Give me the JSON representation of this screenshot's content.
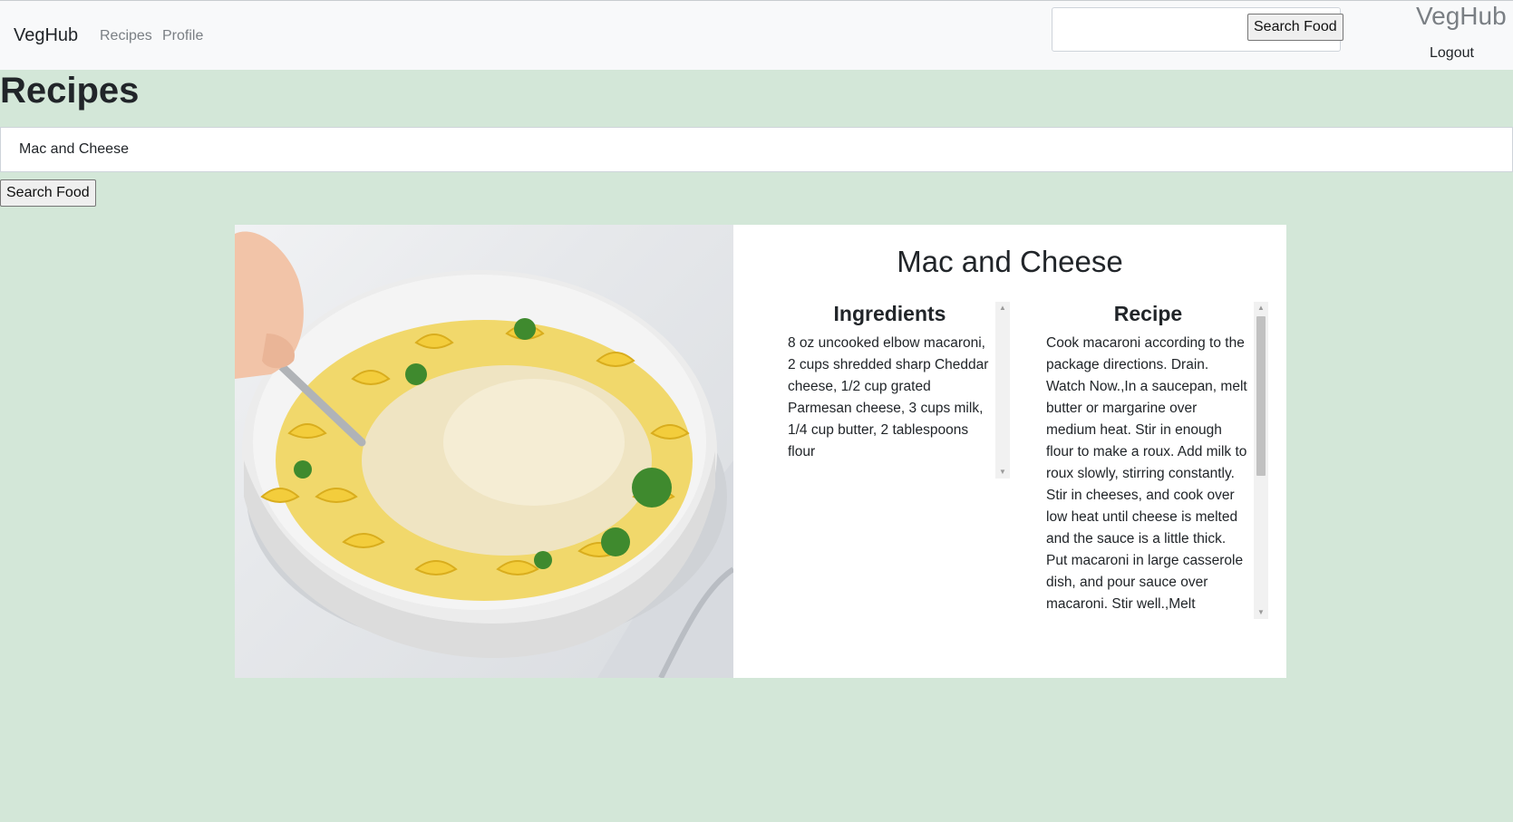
{
  "navbar": {
    "brand": "VegHub",
    "links": [
      "Recipes",
      "Profile"
    ],
    "search_button": "Search Food",
    "right_title": "VegHub",
    "logout": "Logout"
  },
  "page": {
    "title": "Recipes",
    "search_value": "Mac and Cheese",
    "search_button": "Search Food"
  },
  "recipe_card": {
    "title": "Mac and Cheese",
    "ingredients_heading": "Ingredients",
    "ingredients_text": "8 oz uncooked elbow macaroni, 2 cups shredded sharp Cheddar cheese, 1/2 cup grated Parmesan cheese, 3 cups milk, 1/4 cup butter, 2 tablespoons flour",
    "recipe_heading": "Recipe",
    "recipe_text": "Cook macaroni according to the package directions. Drain. Watch Now.,In a saucepan, melt butter or margarine over medium heat. Stir in enough flour to make a roux. Add milk to roux slowly, stirring constantly. Stir in cheeses, and cook over low heat until cheese is melted and the sauce is a little thick. Put macaroni in large casserole dish, and pour sauce over macaroni. Stir well.,Melt"
  },
  "icons": {
    "scroll_up": "scroll-up-arrow-icon",
    "scroll_down": "scroll-down-arrow-icon"
  },
  "colors": {
    "page_background": "#d3e7d8",
    "navbar_background": "#f8f9fa"
  }
}
